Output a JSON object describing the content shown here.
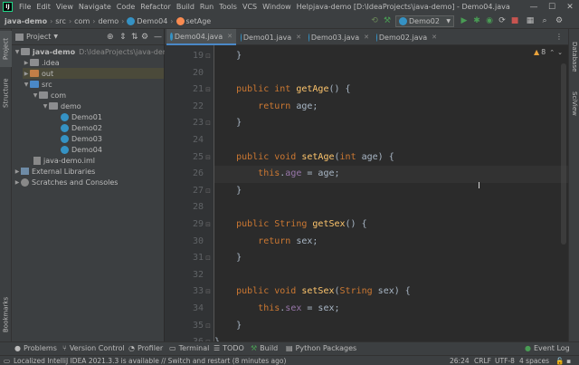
{
  "menu": {
    "logo": "IJ",
    "items": [
      "File",
      "Edit",
      "View",
      "Navigate",
      "Code",
      "Refactor",
      "Build",
      "Run",
      "Tools",
      "VCS",
      "Window",
      "Help"
    ],
    "window_title": "java-demo [D:\\IdeaProjects\\java-demo] - Demo04.java"
  },
  "breadcrumbs": [
    "java-demo",
    "src",
    "com",
    "demo",
    "Demo04",
    "setAge"
  ],
  "run_config": "Demo02",
  "project_panel": {
    "title": "Project",
    "root": "java-demo",
    "root_path": "D:\\IdeaProjects\\java-demo",
    "tree": [
      {
        "label": ".idea",
        "depth": 1,
        "type": "folder"
      },
      {
        "label": "out",
        "depth": 1,
        "type": "folder-orange"
      },
      {
        "label": "src",
        "depth": 1,
        "type": "folder-blue"
      },
      {
        "label": "com",
        "depth": 2,
        "type": "folder"
      },
      {
        "label": "demo",
        "depth": 3,
        "type": "folder"
      },
      {
        "label": "Demo01",
        "depth": 4,
        "type": "class"
      },
      {
        "label": "Demo02",
        "depth": 4,
        "type": "class"
      },
      {
        "label": "Demo03",
        "depth": 4,
        "type": "class"
      },
      {
        "label": "Demo04",
        "depth": 4,
        "type": "class"
      },
      {
        "label": "java-demo.iml",
        "depth": 2,
        "type": "iml"
      },
      {
        "label": "External Libraries",
        "depth": 0,
        "type": "lib"
      },
      {
        "label": "Scratches and Consoles",
        "depth": 0,
        "type": "scratch"
      }
    ]
  },
  "side_labels": {
    "left": [
      "Project",
      "Structure",
      "Bookmarks"
    ],
    "right": [
      "Database",
      "SciView"
    ]
  },
  "tabs": [
    {
      "label": "Demo04.java",
      "active": true
    },
    {
      "label": "Demo01.java",
      "active": false
    },
    {
      "label": "Demo03.java",
      "active": false
    },
    {
      "label": "Demo02.java",
      "active": false
    }
  ],
  "inspection": {
    "warnings": "8"
  },
  "editor": {
    "lines": [
      {
        "n": "19",
        "code": "    }"
      },
      {
        "n": "20",
        "code": ""
      },
      {
        "n": "21",
        "code": "    public int getAge() {"
      },
      {
        "n": "22",
        "code": "        return age;"
      },
      {
        "n": "23",
        "code": "    }"
      },
      {
        "n": "24",
        "code": ""
      },
      {
        "n": "25",
        "code": "    public void setAge(int age) {"
      },
      {
        "n": "26",
        "code": "        this.age = age;",
        "current": true
      },
      {
        "n": "27",
        "code": "    }"
      },
      {
        "n": "28",
        "code": ""
      },
      {
        "n": "29",
        "code": "    public String getSex() {"
      },
      {
        "n": "30",
        "code": "        return sex;"
      },
      {
        "n": "31",
        "code": "    }"
      },
      {
        "n": "32",
        "code": ""
      },
      {
        "n": "33",
        "code": "    public void setSex(String sex) {"
      },
      {
        "n": "34",
        "code": "        this.sex = sex;"
      },
      {
        "n": "35",
        "code": "    }"
      },
      {
        "n": "36",
        "code": "}"
      }
    ]
  },
  "bottom_tools": [
    "Problems",
    "Version Control",
    "Profiler",
    "Terminal",
    "TODO",
    "Build",
    "Python Packages"
  ],
  "event_log": "Event Log",
  "status": {
    "message": "Localized IntelliJ IDEA 2021.3.3 is available // Switch and restart (8 minutes ago)",
    "position": "26:24",
    "line_sep": "CRLF",
    "encoding": "UTF-8",
    "indent": "4 spaces"
  },
  "colors": {
    "accent": "#4a88c7",
    "keyword": "#cc7832",
    "function": "#ffc66d",
    "field": "#9876aa"
  }
}
